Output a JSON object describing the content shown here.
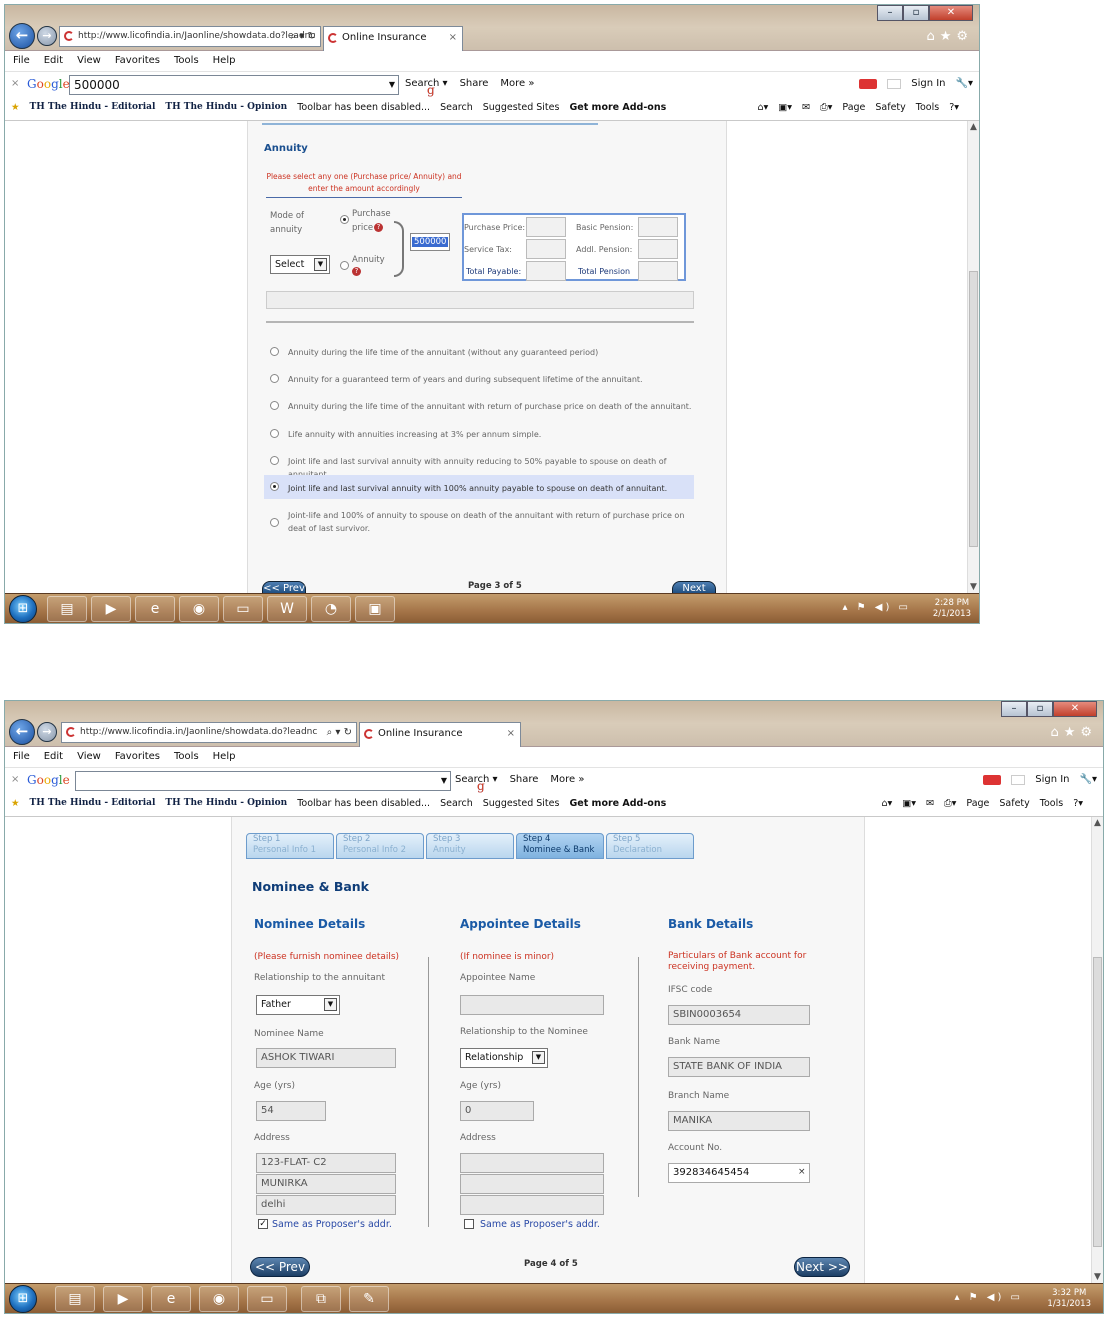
{
  "browser": {
    "url": "http://www.licofindia.in/Jaonline/showdata.do?leadnc",
    "tab_title": "Online Insurance",
    "menu": [
      "File",
      "Edit",
      "View",
      "Favorites",
      "Tools",
      "Help"
    ],
    "google_logo": "Google",
    "google_search_items": [
      "Search",
      "Share",
      "More »"
    ],
    "sign_in": "Sign In",
    "favorites": [
      "TH The Hindu - Editorial",
      "TH The Hindu - Opinion",
      "Toolbar has been disabled...",
      "Search",
      "Suggested Sites",
      "Get more Add-ons"
    ],
    "favorites_right": [
      "Page",
      "Safety",
      "Tools"
    ]
  },
  "screen1": {
    "google_query": "500000",
    "section_title": "Annuity",
    "instruction": "Please select any one (Purchase price/ Annuity) and enter the amount accordingly",
    "mode_label": "Mode of annuity",
    "purchase_price_label": "Purchase price",
    "annuity_label": "Annuity",
    "mode_select": "Select",
    "amount_value": "500000",
    "price_labels": {
      "purchase_price": "Purchase Price:",
      "service_tax": "Service Tax:",
      "total_payable": "Total Payable:",
      "basic_pension": "Basic Pension:",
      "addl_pension": "Addl. Pension:",
      "total_pension": "Total Pension"
    },
    "options": [
      "Annuity during the life time of the annuitant (without any guaranteed period)",
      "Annuity for a guaranteed term of years and during subsequent lifetime of the annuitant.",
      "Annuity during the life time of the annuitant with return of purchase price on death of the annuitant.",
      "Life annuity with annuities increasing at 3% per annum simple.",
      "Joint life and last survival annuity with annuity reducing to 50% payable to spouse on death of annuitant.",
      "Joint life and last survival annuity with 100% annuity payable to spouse on death of annuitant.",
      "Joint-life and 100% of annuity to spouse on death of the annuitant with return of purchase price on deat of last survivor."
    ],
    "selected_option_index": 5,
    "prev_label": "<< Prev",
    "next_label": "Next >>",
    "page_label": "Page 3 of 5",
    "clock_time": "2:28 PM",
    "clock_date": "2/1/2013"
  },
  "screen2": {
    "google_query": "",
    "steps": [
      {
        "step": "Step 1",
        "label": "Personal Info 1"
      },
      {
        "step": "Step 2",
        "label": "Personal Info 2"
      },
      {
        "step": "Step 3",
        "label": "Annuity"
      },
      {
        "step": "Step 4",
        "label": "Nominee & Bank"
      },
      {
        "step": "Step 5",
        "label": "Declaration"
      }
    ],
    "active_step_index": 3,
    "page_title": "Nominee & Bank",
    "nominee": {
      "heading": "Nominee Details",
      "note": "(Please furnish nominee details)",
      "relationship_label": "Relationship to the annuitant",
      "relationship_value": "Father",
      "name_label": "Nominee Name",
      "name_value": "ASHOK TIWARI",
      "age_label": "Age (yrs)",
      "age_value": "54",
      "address_label": "Address",
      "address": [
        "123-FLAT- C2",
        "MUNIRKA",
        "delhi"
      ],
      "same_as_label": "Same as Proposer's addr."
    },
    "appointee": {
      "heading": "Appointee Details",
      "note": "(If nominee is minor)",
      "name_label": "Appointee Name",
      "name_value": "",
      "relationship_label": "Relationship to the Nominee",
      "relationship_value": "Relationship",
      "age_label": "Age (yrs)",
      "age_value": "0",
      "address_label": "Address",
      "address": [
        "",
        "",
        ""
      ],
      "same_as_label": "Same as Proposer's addr."
    },
    "bank": {
      "heading": "Bank Details",
      "note": "Particulars of Bank account for receiving payment.",
      "ifsc_label": "IFSC code",
      "ifsc_value": "SBIN0003654",
      "bank_label": "Bank Name",
      "bank_value": "STATE BANK OF INDIA",
      "branch_label": "Branch Name",
      "branch_value": "MANIKA",
      "account_label": "Account No.",
      "account_value": "392834645454"
    },
    "prev_label": "<< Prev",
    "next_label": "Next >>",
    "page_label": "Page 4 of 5",
    "clock_time": "3:32 PM",
    "clock_date": "1/31/2013"
  },
  "colors": {
    "section_blue": "#1a4f8f",
    "note_red": "#cc3322",
    "step_active": "#7fb2df",
    "taskbar": "#a47448"
  }
}
